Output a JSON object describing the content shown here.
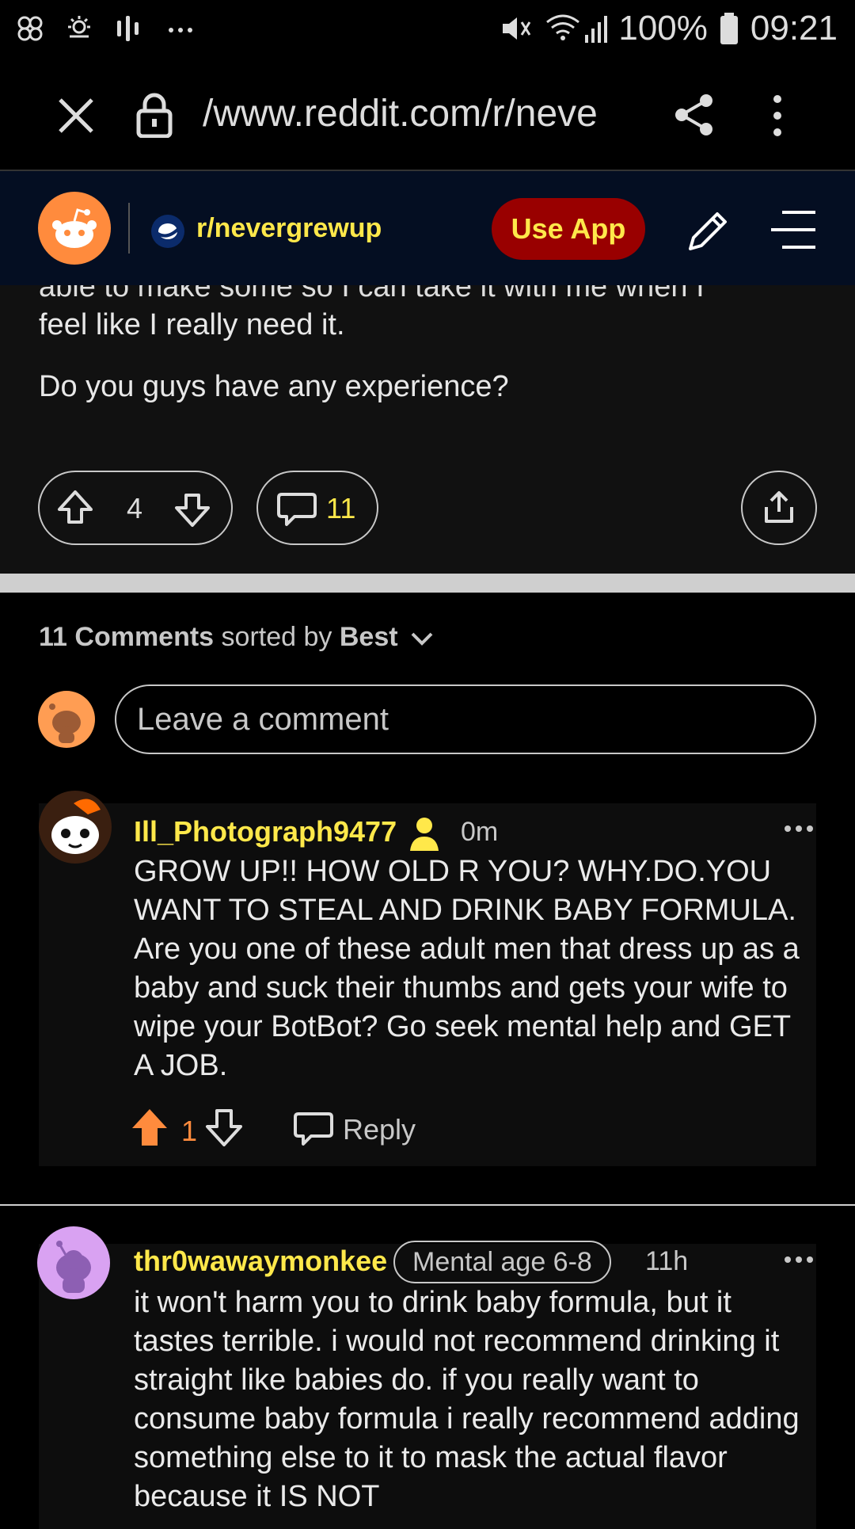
{
  "status_bar": {
    "battery": "100%",
    "time": "09:21"
  },
  "browser": {
    "url": "/www.reddit.com/r/neve"
  },
  "header": {
    "subreddit": "r/nevergrewup",
    "use_app_label": "Use App"
  },
  "post": {
    "cut_text": "able to make some so I can take it with me when I",
    "para1": "feel like I really need it.",
    "para2": "Do you guys have any experience?",
    "vote_count": "4",
    "comment_count": "11"
  },
  "comments_section": {
    "count_label": "11 Comments",
    "sorted_by_label": "sorted by",
    "sort_value": "Best",
    "input_placeholder": "Leave a comment"
  },
  "comments": [
    {
      "author": "Ill_Photograph9477",
      "time": "0m",
      "text": "GROW UP!! HOW OLD R YOU? WHY.DO.YOU WANT TO STEAL AND DRINK BABY FORMULA. Are you one of these adult men that dress up as a baby and suck their thumbs and gets your wife to wipe your BotBot? Go seek mental help and GET A JOB.",
      "score": "1",
      "reply_label": "Reply"
    },
    {
      "author": "thr0wawaymonkee",
      "flair": "Mental age 6-8",
      "time": "11h",
      "text": "it won't harm you to drink baby formula, but it tastes terrible. i would not recommend drinking it straight like babies do. if you really want to consume baby formula i really recommend adding something else to it to mask the actual flavor because it IS NOT"
    }
  ],
  "colors": {
    "accent_yellow": "#ffe84a",
    "use_app_bg": "#990000",
    "upvote_orange": "#ff8b3d",
    "header_bg": "#040e22"
  }
}
